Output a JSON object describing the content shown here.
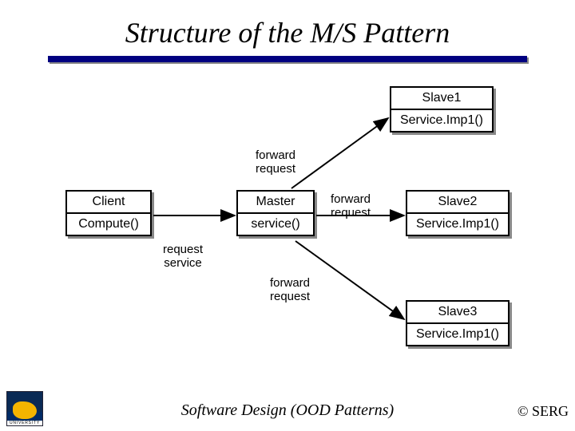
{
  "title": "Structure of the M/S Pattern",
  "boxes": {
    "client": {
      "name": "Client",
      "method": "Compute()"
    },
    "master": {
      "name": "Master",
      "method": "service()"
    },
    "slave1": {
      "name": "Slave1",
      "method": "Service.Imp1()"
    },
    "slave2": {
      "name": "Slave2",
      "method": "Service.Imp1()"
    },
    "slave3": {
      "name": "Slave3",
      "method": "Service.Imp1()"
    }
  },
  "labels": {
    "fwd1": "forward\nrequest",
    "fwd2": "forward\nrequest",
    "fwd3": "forward\nrequest",
    "reqservice": "request\nservice"
  },
  "footer": {
    "caption": "Software Design (OOD Patterns)",
    "copyright": "© SERG",
    "logo_text": "UNIVERSITY"
  }
}
